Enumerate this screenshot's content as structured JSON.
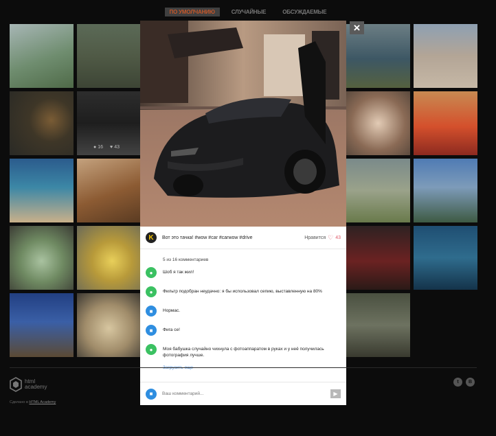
{
  "filters": [
    {
      "label": "По умолчанию",
      "active": true
    },
    {
      "label": "Случайные",
      "active": false
    },
    {
      "label": "Обсуждаемые",
      "active": false
    }
  ],
  "tile_stats": {
    "comments": "16",
    "likes": "43"
  },
  "modal": {
    "close_label": "×",
    "post": {
      "author_initial": "K",
      "caption": "Вот это тачка! #wow #car #carwow #drive",
      "like_label": "Нравится",
      "like_count": "43"
    },
    "comment_count": "5 из 16 комментариев",
    "comments": [
      {
        "avatar": "green",
        "text": "Шоб я так жил!"
      },
      {
        "avatar": "green",
        "text": "Фильтр подобран неудачно: я бы использовал сепию, выставленную на 80%"
      },
      {
        "avatar": "blue",
        "text": "Нормас."
      },
      {
        "avatar": "blue",
        "text": "Фига се!"
      },
      {
        "avatar": "green",
        "text": "Моя бабушка случайно чихнула с фотоаппаратом в руках и у неё получилась фотография лучше."
      }
    ],
    "load_more": "Загрузить еще",
    "composer_placeholder": "Ваш комментарий..."
  },
  "footer": {
    "brand_line1": "html",
    "brand_line2": "academy",
    "made_prefix": "Сделано в",
    "made_link": "HTML Academy",
    "social": [
      "twitter-icon",
      "vk-icon"
    ]
  },
  "colors": {
    "accent": "#c4572a",
    "background": "#0c0c0c",
    "like": "#e05a6a",
    "link": "#4a8bd8"
  }
}
